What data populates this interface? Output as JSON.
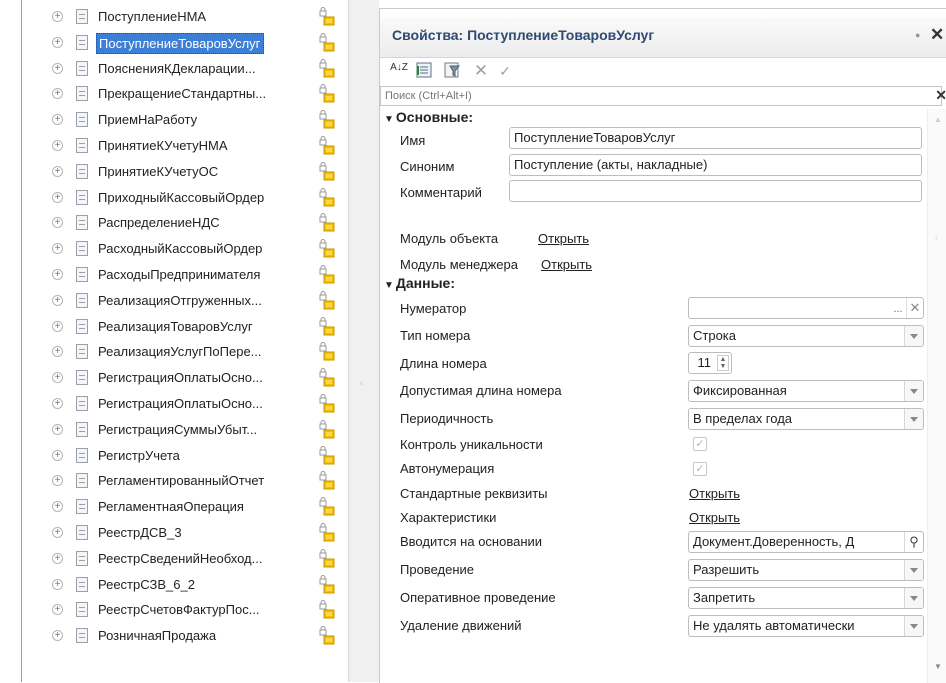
{
  "tree": {
    "items": [
      {
        "label": "ПоступлениеНМА",
        "selected": false
      },
      {
        "label": "ПоступлениеТоваровУслуг",
        "selected": true
      },
      {
        "label": "ПоясненияКДекларации...",
        "selected": false
      },
      {
        "label": "ПрекращениеСтандартны...",
        "selected": false
      },
      {
        "label": "ПриемНаРаботу",
        "selected": false
      },
      {
        "label": "ПринятиеКУчетуНМА",
        "selected": false
      },
      {
        "label": "ПринятиеКУчетуОС",
        "selected": false
      },
      {
        "label": "ПриходныйКассовыйОрдер",
        "selected": false
      },
      {
        "label": "РаспределениеНДС",
        "selected": false
      },
      {
        "label": "РасходныйКассовыйОрдер",
        "selected": false
      },
      {
        "label": "РасходыПредпринимателя",
        "selected": false
      },
      {
        "label": "РеализацияОтгруженных...",
        "selected": false
      },
      {
        "label": "РеализацияТоваровУслуг",
        "selected": false
      },
      {
        "label": "РеализацияУслугПоПере...",
        "selected": false
      },
      {
        "label": "РегистрацияОплатыОсно...",
        "selected": false
      },
      {
        "label": "РегистрацияОплатыОсно...",
        "selected": false
      },
      {
        "label": "РегистрацияСуммыУбыт...",
        "selected": false
      },
      {
        "label": "РегистрУчета",
        "selected": false
      },
      {
        "label": "РегламентированныйОтчет",
        "selected": false
      },
      {
        "label": "РегламентнаяОперация",
        "selected": false
      },
      {
        "label": "РеестрДСВ_3",
        "selected": false
      },
      {
        "label": "РеестрСведенийНеобход...",
        "selected": false
      },
      {
        "label": "РеестрСЗВ_6_2",
        "selected": false
      },
      {
        "label": "РеестрСчетовФактурПос...",
        "selected": false
      },
      {
        "label": "РозничнаяПродажа",
        "selected": false
      }
    ]
  },
  "panel": {
    "title": "Свойства: ПоступлениеТоваровУслуг",
    "search_placeholder": "Поиск (Ctrl+Alt+I)",
    "toolbar": {
      "sort_label": "A↓Z"
    },
    "sections": {
      "main": "Основные:",
      "data": "Данные:"
    },
    "main": {
      "name_label": "Имя",
      "name_value": "ПоступлениеТоваровУслуг",
      "synonym_label": "Синоним",
      "synonym_value": "Поступление (акты, накладные)",
      "comment_label": "Комментарий",
      "comment_value": "",
      "object_module_label": "Модуль объекта",
      "object_module_link": "Открыть",
      "manager_module_label": "Модуль менеджера",
      "manager_module_link": "Открыть"
    },
    "data": {
      "numerator_label": "Нумератор",
      "numerator_value": "",
      "number_type_label": "Тип номера",
      "number_type_value": "Строка",
      "number_length_label": "Длина номера",
      "number_length_value": "11",
      "allowed_length_label": "Допустимая длина номера",
      "allowed_length_value": "Фиксированная",
      "periodicity_label": "Периодичность",
      "periodicity_value": "В пределах года",
      "uniqueness_label": "Контроль уникальности",
      "uniqueness_checked": true,
      "autonumber_label": "Автонумерация",
      "autonumber_checked": true,
      "standard_attrs_label": "Стандартные реквизиты",
      "standard_attrs_link": "Открыть",
      "characteristics_label": "Характеристики",
      "characteristics_link": "Открыть",
      "based_on_label": "Вводится на основании",
      "based_on_value": "Документ.Доверенность, Д",
      "posting_label": "Проведение",
      "posting_value": "Разрешить",
      "realtime_posting_label": "Оперативное проведение",
      "realtime_posting_value": "Запретить",
      "delete_movements_label": "Удаление движений",
      "delete_movements_value": "Не удалять автоматически"
    }
  }
}
